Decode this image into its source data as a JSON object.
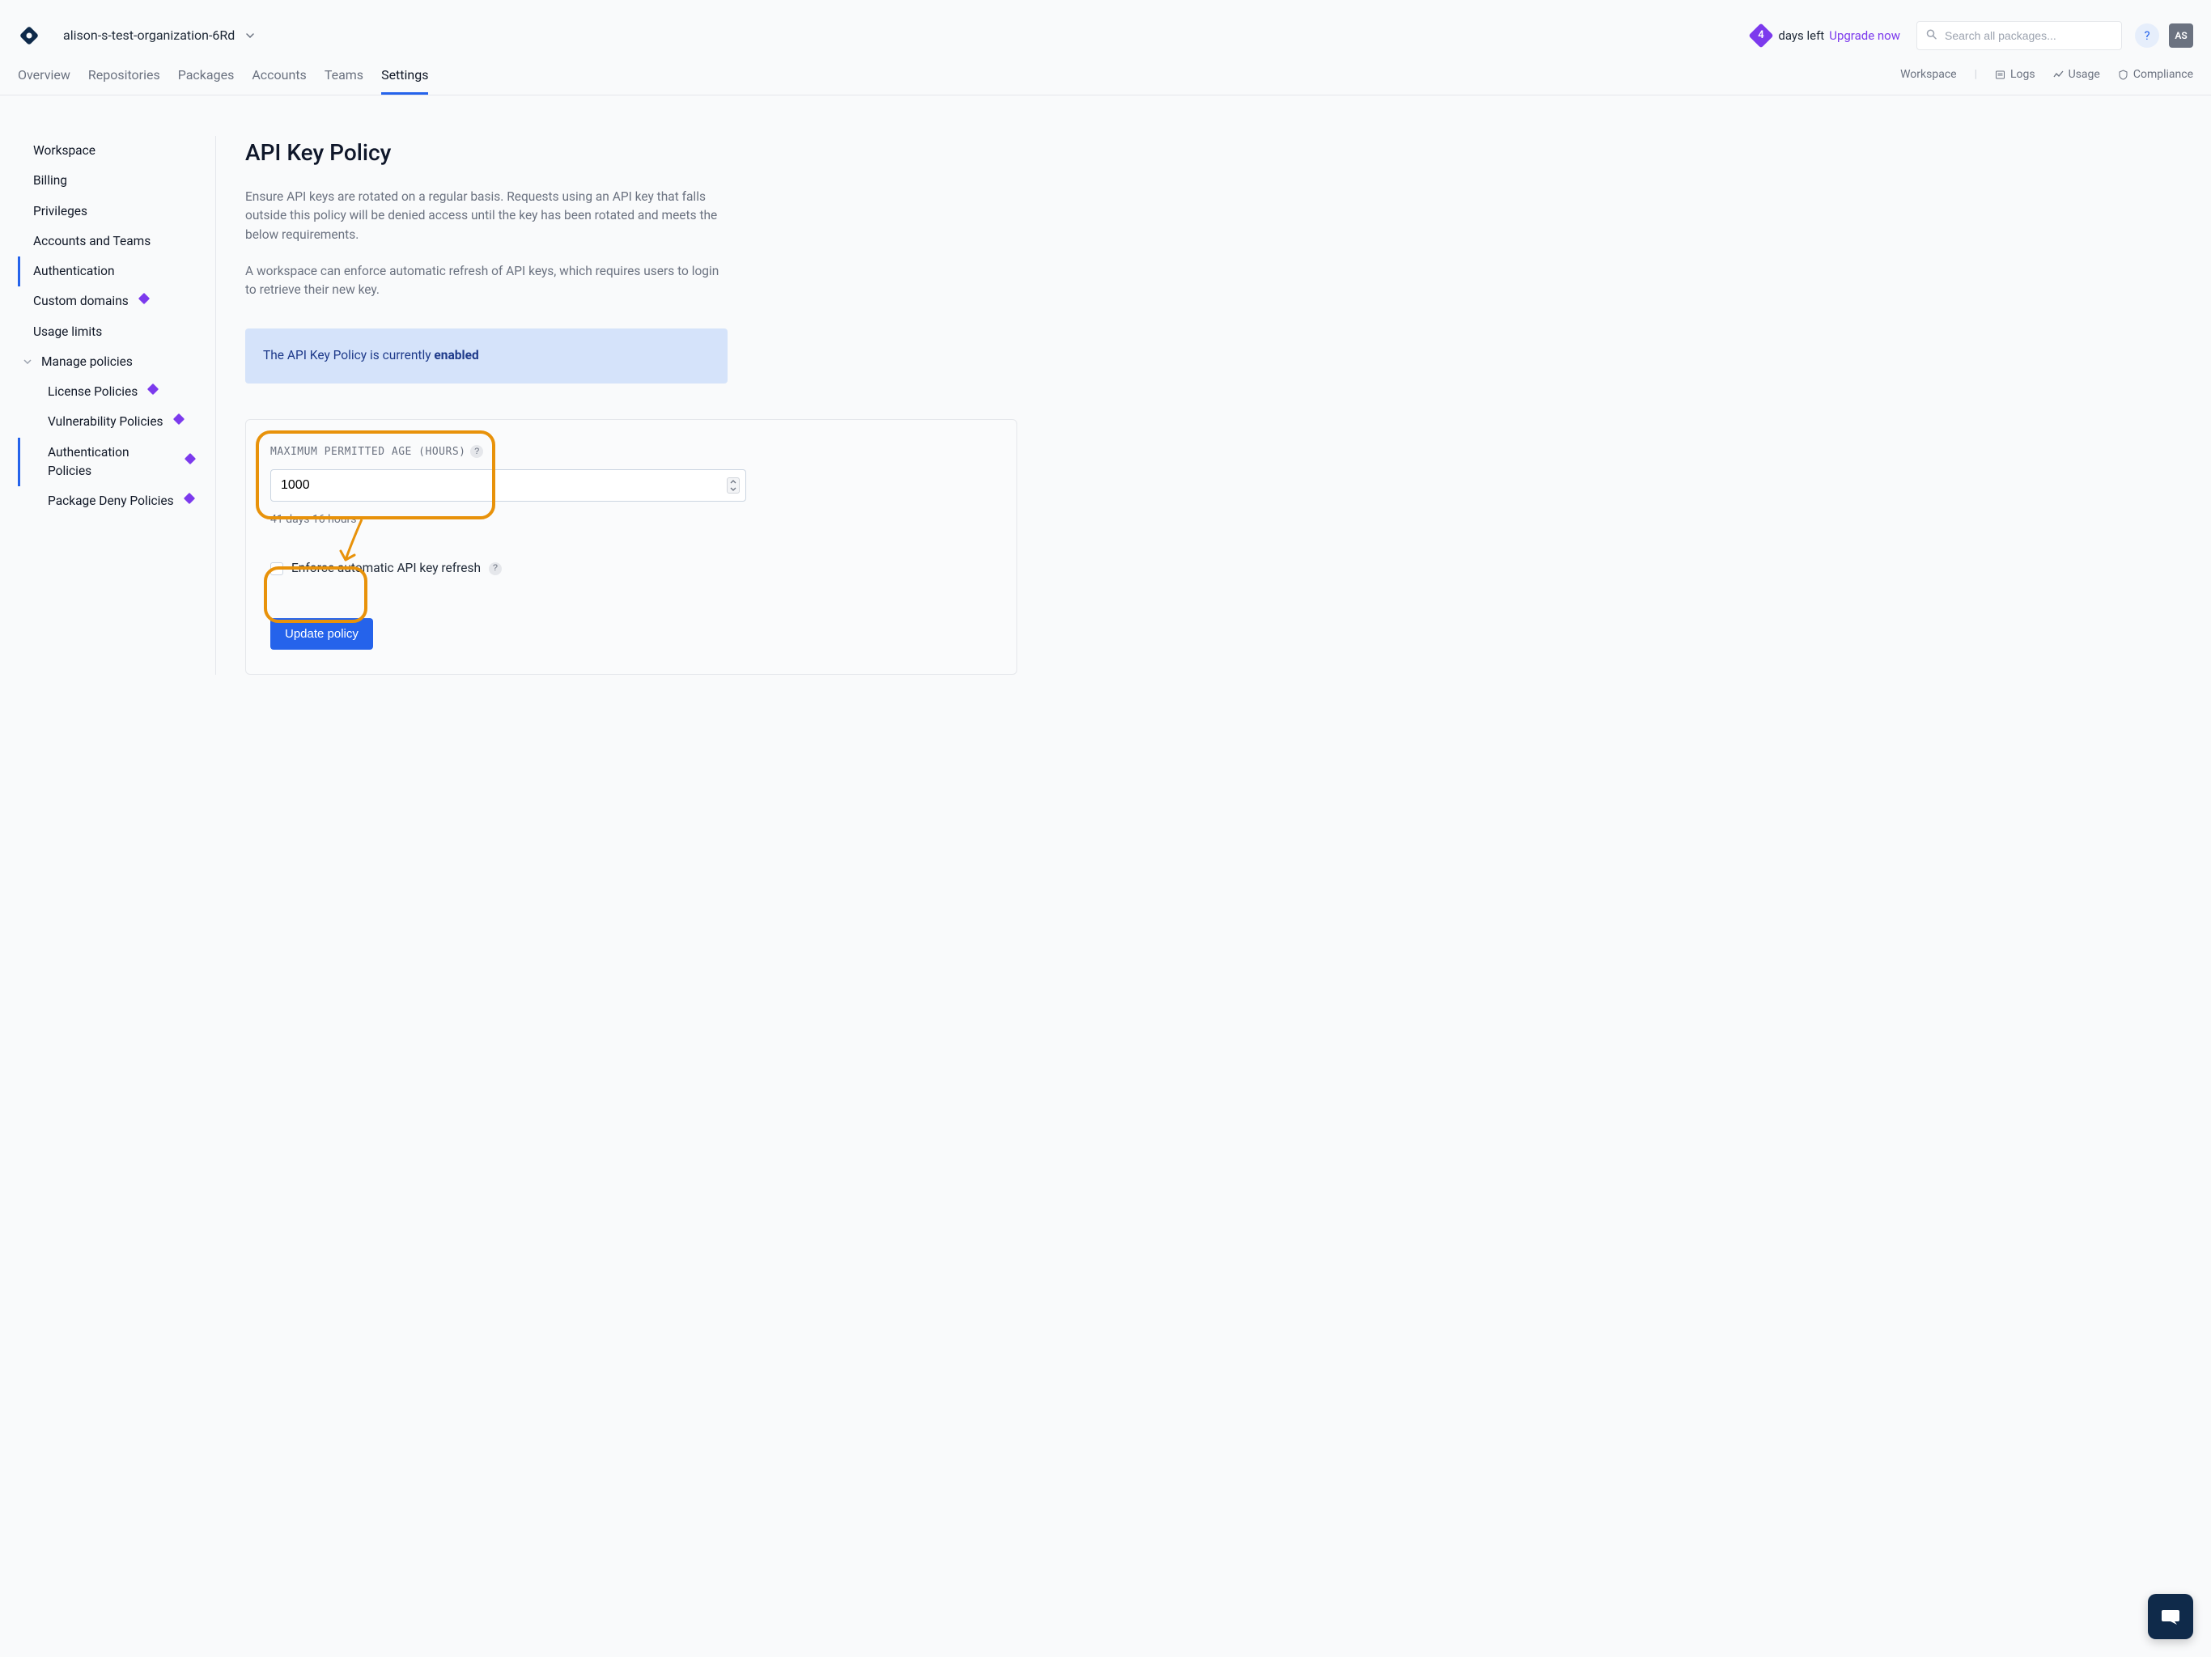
{
  "header": {
    "org_name": "alison-s-test-organization-6Rd",
    "trial_days": "4",
    "trial_label": "days left",
    "upgrade_label": "Upgrade now",
    "search_placeholder": "Search all packages...",
    "help_label": "?",
    "avatar_initials": "AS"
  },
  "nav": {
    "tabs": [
      {
        "label": "Overview"
      },
      {
        "label": "Repositories"
      },
      {
        "label": "Packages"
      },
      {
        "label": "Accounts"
      },
      {
        "label": "Teams"
      },
      {
        "label": "Settings"
      }
    ],
    "right": {
      "workspace": "Workspace",
      "logs": "Logs",
      "usage": "Usage",
      "compliance": "Compliance"
    }
  },
  "sidebar": {
    "items": [
      {
        "label": "Workspace"
      },
      {
        "label": "Billing"
      },
      {
        "label": "Privileges"
      },
      {
        "label": "Accounts and Teams"
      },
      {
        "label": "Authentication"
      },
      {
        "label": "Custom domains"
      },
      {
        "label": "Usage limits"
      },
      {
        "label": "Manage policies"
      }
    ],
    "sub_items": [
      {
        "label": "License Policies"
      },
      {
        "label": "Vulnerability Policies"
      },
      {
        "label": "Authentication Policies"
      },
      {
        "label": "Package Deny Policies"
      }
    ]
  },
  "page": {
    "title": "API Key Policy",
    "desc1": "Ensure API keys are rotated on a regular basis. Requests using an API key that falls outside this policy will be denied access until the key has been rotated and meets the below requirements.",
    "desc2": "A workspace can enforce automatic refresh of API keys, which requires users to login to retrieve their new key.",
    "banner_prefix": "The API Key Policy is currently ",
    "banner_status": "enabled",
    "form": {
      "label": "MAXIMUM PERMITTED AGE (HOURS)",
      "value": "1000",
      "helper": "41 days 16 hours",
      "checkbox_label": "Enforce automatic API key refresh",
      "submit_label": "Update policy"
    }
  }
}
